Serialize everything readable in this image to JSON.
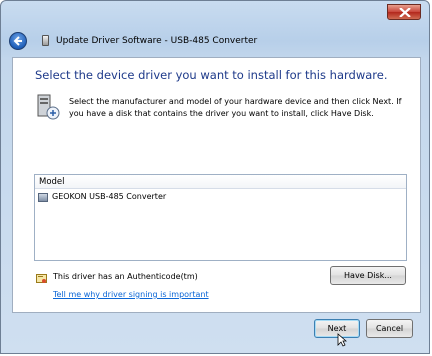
{
  "window": {
    "title": "Update Driver Software - USB-485 Converter"
  },
  "content": {
    "heading": "Select the device driver you want to install for this hardware.",
    "description": "Select the manufacturer and model of your hardware device and then click Next. If you have a disk that contains the driver you want to install, click Have Disk."
  },
  "model_list": {
    "column_header": "Model",
    "items": [
      "GEOKON USB-485 Converter"
    ]
  },
  "signing": {
    "status": "This driver has an Authenticode(tm)",
    "link": "Tell me why driver signing is important"
  },
  "buttons": {
    "have_disk": "Have Disk...",
    "next": "Next",
    "cancel": "Cancel"
  }
}
